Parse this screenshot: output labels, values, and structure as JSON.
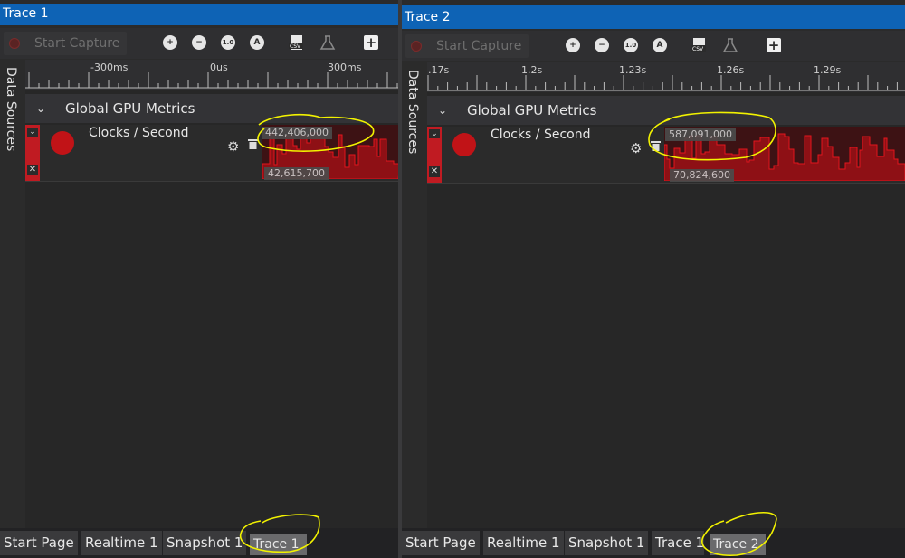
{
  "panels": [
    {
      "title": "Trace 1",
      "toolbar": {
        "start_capture": "Start Capture",
        "zoom_in": "+",
        "zoom_out": "−",
        "zoom_reset": "1.0",
        "zoom_auto": "A"
      },
      "sidebar_label": "Data Sources",
      "ruler_labels": [
        "-300ms",
        "0us",
        "300ms"
      ],
      "group": {
        "name": "Global GPU Metrics"
      },
      "metric": {
        "name": "Clocks / Second",
        "max": "442,406,000",
        "min": "42,615,700"
      },
      "tabs": [
        "Start Page",
        "Realtime 1",
        "Snapshot 1",
        "Trace 1"
      ],
      "active_tab": "Trace 1"
    },
    {
      "title": "Trace 2",
      "toolbar": {
        "start_capture": "Start Capture",
        "zoom_in": "+",
        "zoom_out": "−",
        "zoom_reset": "1.0",
        "zoom_auto": "A"
      },
      "sidebar_label": "Data Sources",
      "ruler_labels": [
        ".17s",
        "1.2s",
        "1.23s",
        "1.26s",
        "1.29s"
      ],
      "group": {
        "name": "Global GPU Metrics"
      },
      "metric": {
        "name": "Clocks / Second",
        "max": "587,091,000",
        "min": "70,824,600"
      },
      "tabs": [
        "Start Page",
        "Realtime 1",
        "Snapshot 1",
        "Trace 1",
        "Trace 2"
      ],
      "active_tab": "Trace 2"
    }
  ],
  "colors": {
    "title_bar": "#0e63b5",
    "metric_red": "#c11317",
    "highlight": "#f2f200"
  }
}
